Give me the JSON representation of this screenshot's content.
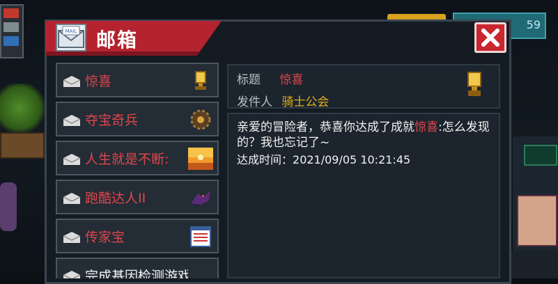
{
  "header": {
    "title": "邮箱",
    "close_icon": "close-icon",
    "mail_icon": "mail-envelope-icon"
  },
  "hud": {
    "teal_value": "59"
  },
  "mail_list": [
    {
      "title": "惊喜",
      "color": "#e0454c",
      "icon": "golden-trophy-icon"
    },
    {
      "title": "夺宝奇兵",
      "color": "#e0454c",
      "icon": "bronze-gear-icon"
    },
    {
      "title": "人生就是不断:",
      "color": "#e0454c",
      "icon": "sunset-desert-icon"
    },
    {
      "title": "跑酷达人II",
      "color": "#e0454c",
      "icon": "purple-creature-icon"
    },
    {
      "title": "传家宝",
      "color": "#e0454c",
      "icon": "document-grid-icon"
    },
    {
      "title": "完成基因检测游戏",
      "color": "#f3f3f3",
      "icon": ""
    }
  ],
  "detail": {
    "subject_label": "标题",
    "subject_value": "惊喜",
    "sender_label": "发件人",
    "sender_value": "骑士公会",
    "body_prefix": "亲爱的冒险者，恭喜你达成了成就",
    "body_highlight": "惊喜",
    "body_suffix": ":怎么发现的？我也忘记了~",
    "time_label": "达成时间：",
    "time_value": "2021/09/05 10:21:45",
    "icon": "golden-trophy-icon"
  },
  "colors": {
    "accent_red": "#b5232f",
    "highlight_text": "#e0454c",
    "sender_gold": "#e0b020",
    "panel_bg": "#141b22"
  }
}
